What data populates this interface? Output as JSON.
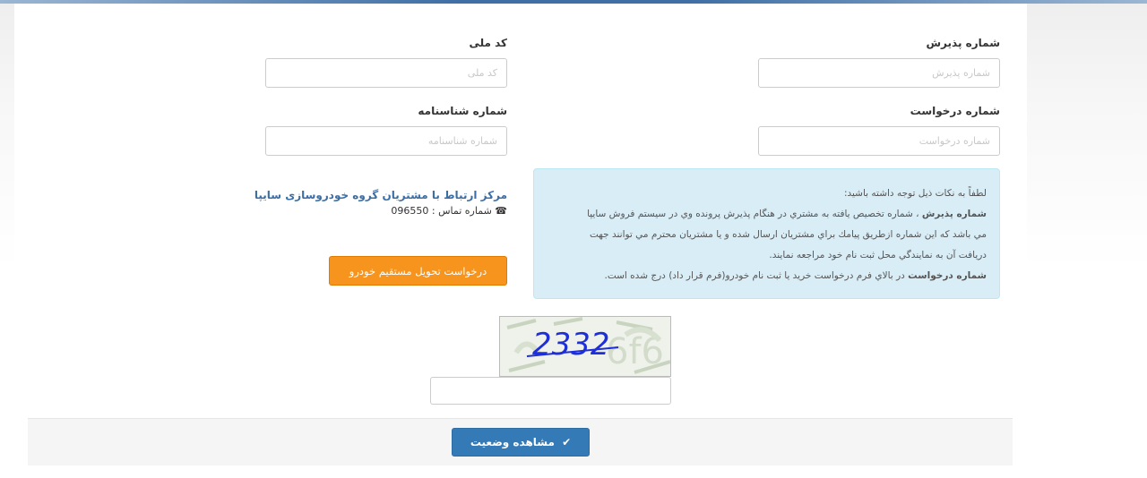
{
  "form": {
    "reception_label": "شماره پذیرش",
    "reception_placeholder": "شماره پذیرش",
    "national_code_label": "کد ملی",
    "national_code_placeholder": "کد ملی",
    "request_label": "شماره درخواست",
    "request_placeholder": "شماره درخواست",
    "birth_cert_label": "شماره شناسنامه",
    "birth_cert_placeholder": "شماره شناسنامه"
  },
  "notice": {
    "intro": "لطفاً به نکات ذیل توجه داشته باشید:",
    "term1": "شماره پذیرش",
    "term1_text1": " ، شماره تخصیص یافته به مشتري در هنگام پذیرش پرونده وي در سیستم فروش سایپا",
    "term1_text2": "مي باشد که این شماره ازطریق پیامك براي مشتریان ارسال شده و یا مشتریان محترم مي توانند جهت",
    "term1_text3": "دریافت آن به نمایندگي محل ثبت نام خود مراجعه نمایند.",
    "term2": "شماره درخواست",
    "term2_text": " در بالاي فرم درخواست خرید یا ثبت نام خودرو(فرم قرار داد) درج شده است."
  },
  "contact": {
    "title": "مرکز ارتباط با مشتریان گروه خودروسازی سایپا",
    "phone_label": "شماره تماس : 096550",
    "phone_icon": "phone-icon"
  },
  "actions": {
    "direct_delivery_label": "درخواست تحویل مستقیم خودرو",
    "view_status_label": "مشاهده وضعیت",
    "view_status_icon": "check-icon"
  },
  "captcha": {
    "code": "2332"
  },
  "colors": {
    "primary": "#337ab7",
    "accent_orange": "#f7941d",
    "info_bg": "#d9edf7",
    "link": "#3a6ea5"
  }
}
